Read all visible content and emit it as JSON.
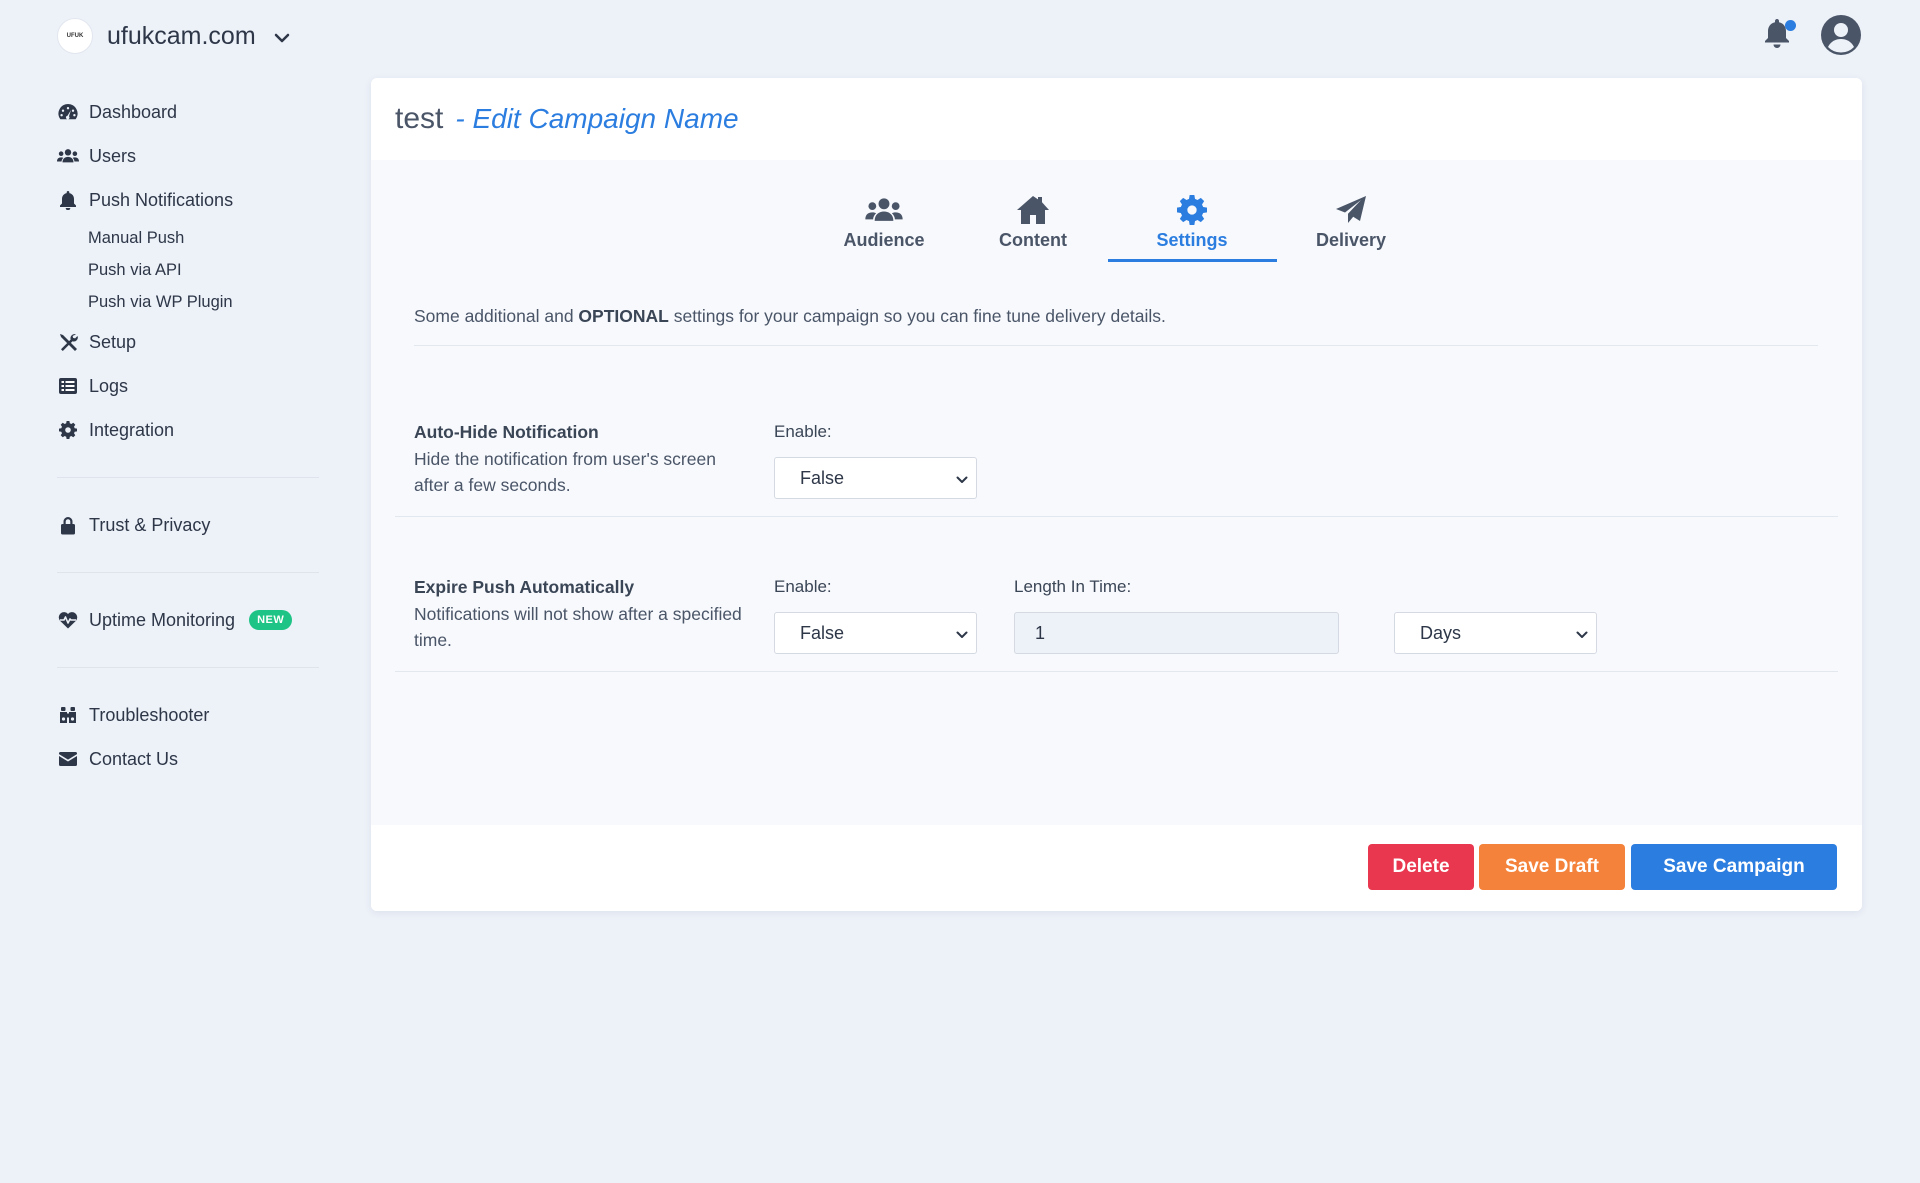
{
  "header": {
    "site_logo_text": "UFUK",
    "site_name": "ufukcam.com"
  },
  "sidebar": {
    "items": [
      {
        "label": "Dashboard",
        "icon": "dashboard-icon"
      },
      {
        "label": "Users",
        "icon": "users-icon"
      },
      {
        "label": "Push Notifications",
        "icon": "bell-icon"
      }
    ],
    "sub_items": [
      "Manual Push",
      "Push via API",
      "Push via WP Plugin"
    ],
    "items2": [
      {
        "label": "Setup",
        "icon": "tools-icon"
      },
      {
        "label": "Logs",
        "icon": "list-icon"
      },
      {
        "label": "Integration",
        "icon": "gear-icon"
      }
    ],
    "trust": {
      "label": "Trust & Privacy",
      "icon": "lock-icon"
    },
    "uptime": {
      "label": "Uptime Monitoring",
      "badge": "NEW",
      "icon": "heartbeat-icon"
    },
    "troubleshooter": {
      "label": "Troubleshooter",
      "icon": "binoculars-icon"
    },
    "contact": {
      "label": "Contact Us",
      "icon": "envelope-icon"
    }
  },
  "campaign": {
    "name": "test",
    "edit_label": "- Edit Campaign Name"
  },
  "tabs": [
    {
      "label": "Audience",
      "icon": "users-icon"
    },
    {
      "label": "Content",
      "icon": "home-icon"
    },
    {
      "label": "Settings",
      "icon": "gear-icon",
      "active": true
    },
    {
      "label": "Delivery",
      "icon": "paper-plane-icon"
    }
  ],
  "intro": {
    "before": "Some additional and ",
    "bold": "OPTIONAL",
    "after": " settings for your campaign so you can fine tune delivery details."
  },
  "auto_hide": {
    "title": "Auto-Hide Notification",
    "description": "Hide the notification from user's screen after a few seconds.",
    "enable_label": "Enable:",
    "enable_value": "False"
  },
  "expire": {
    "title": "Expire Push Automatically",
    "description": "Notifications will not show after a specified time.",
    "enable_label": "Enable:",
    "enable_value": "False",
    "length_label": "Length In Time:",
    "length_value": "1",
    "unit_value": "Days"
  },
  "buttons": {
    "delete": "Delete",
    "save_draft": "Save Draft",
    "save_campaign": "Save Campaign"
  },
  "colors": {
    "accent": "#2b7de0",
    "delete": "#e8374f",
    "draft": "#f4823a",
    "new_badge": "#1ec485"
  }
}
